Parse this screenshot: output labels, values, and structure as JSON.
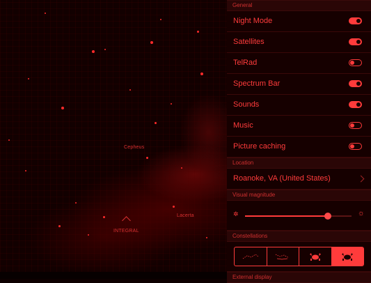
{
  "sky": {
    "labels": {
      "cepheus": "Cepheus",
      "integral": "INTEGRAL",
      "lacerta": "Lacerta"
    }
  },
  "settings": {
    "general_header": "General",
    "toggles": [
      {
        "label": "Night Mode",
        "on": true
      },
      {
        "label": "Satellites",
        "on": true
      },
      {
        "label": "TelRad",
        "on": false
      },
      {
        "label": "Spectrum Bar",
        "on": true
      },
      {
        "label": "Sounds",
        "on": true
      },
      {
        "label": "Music",
        "on": false
      },
      {
        "label": "Picture caching",
        "on": false
      }
    ],
    "location_header": "Location",
    "location_value": "Roanoke, VA (United States)",
    "visual_magnitude_header": "Visual magnitude",
    "visual_magnitude_level": 0.78,
    "constellations_header": "Constellations",
    "constellation_options": [
      {
        "icon": "constellation-lines-icon",
        "active": false
      },
      {
        "icon": "constellation-lines-boundaries-icon",
        "active": false
      },
      {
        "icon": "constellation-art-icon",
        "active": false
      },
      {
        "icon": "constellation-art-filled-icon",
        "active": true
      }
    ],
    "external_display_header": "External display"
  },
  "colors": {
    "accent": "#ff3b3b",
    "background": "#160000"
  }
}
